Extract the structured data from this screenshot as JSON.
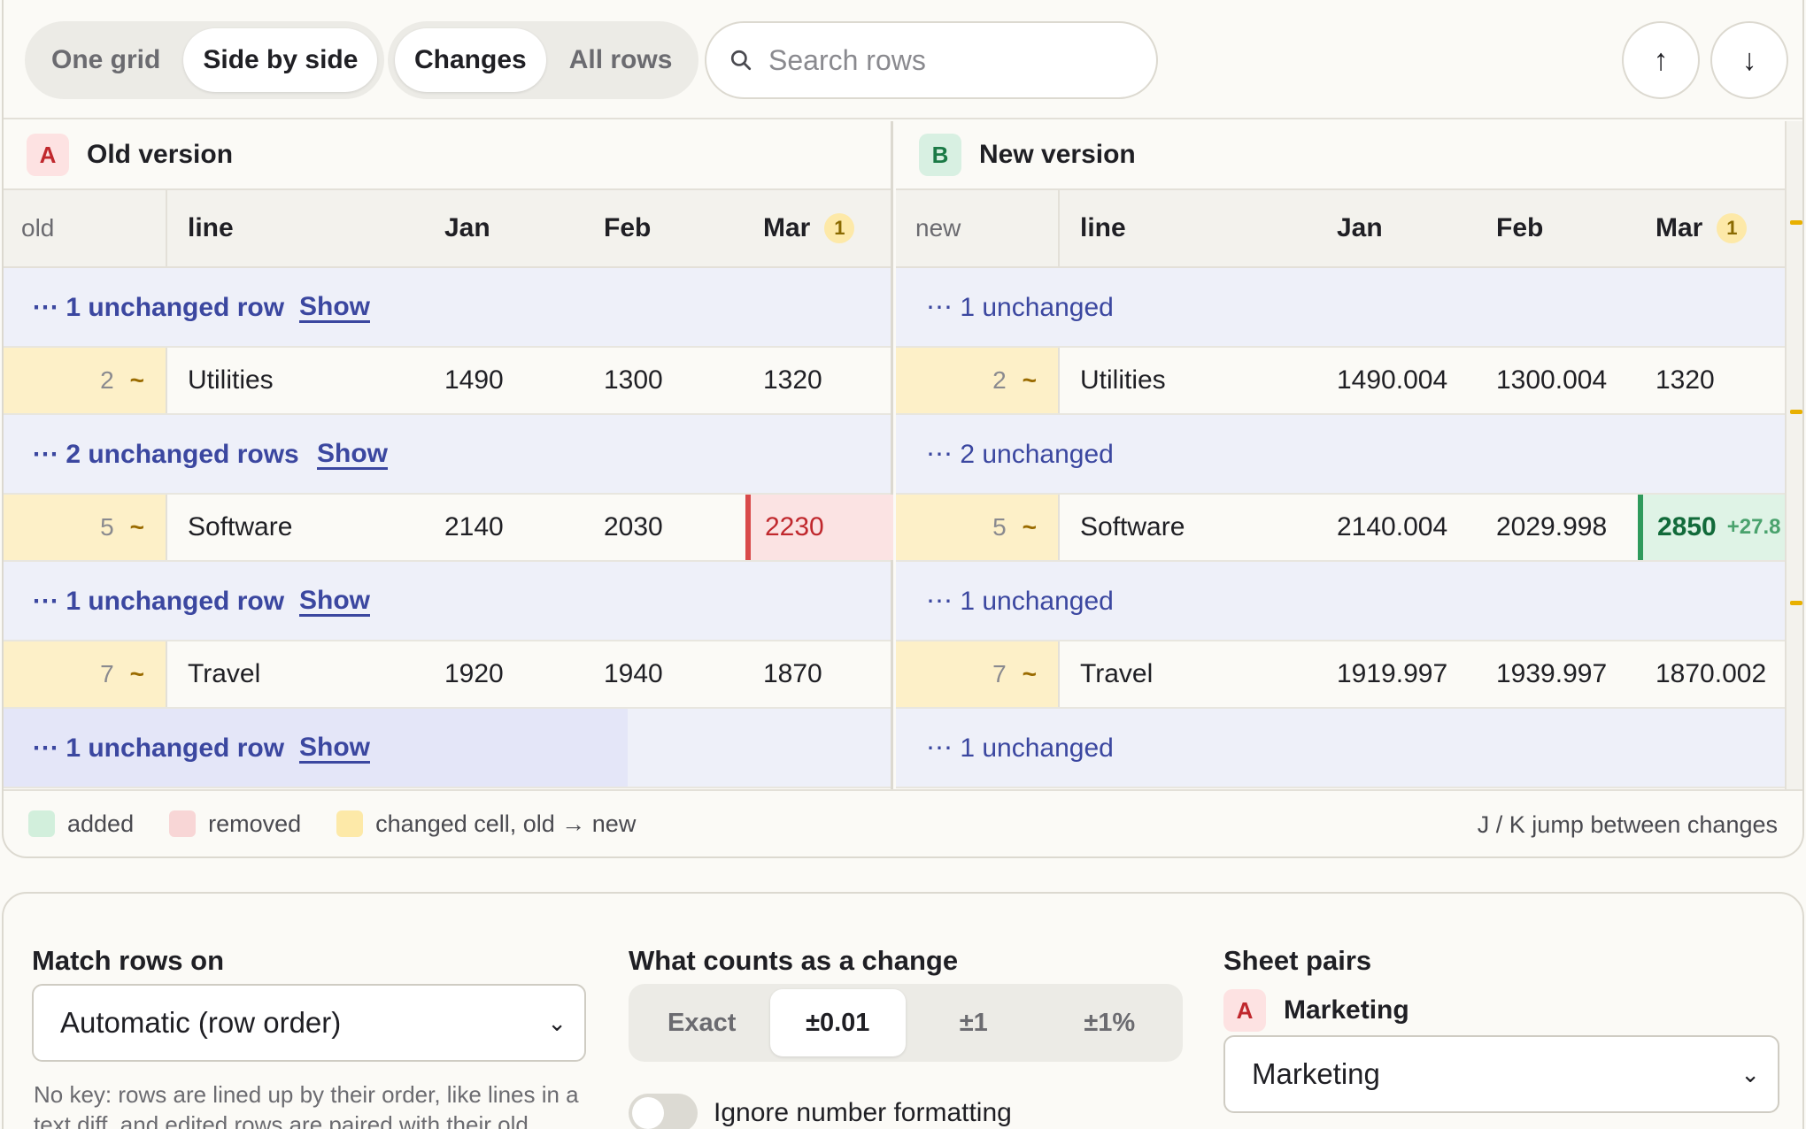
{
  "toolbar": {
    "view_modes": [
      "One grid",
      "Side by side"
    ],
    "row_modes": [
      "Changes",
      "All rows"
    ],
    "search_placeholder": "Search rows",
    "prev_label": "↑",
    "next_label": "↓"
  },
  "left_pane": {
    "badge": "A",
    "title": "Old version",
    "index_header": "old",
    "columns": [
      "line",
      "Jan",
      "Feb",
      "Mar"
    ],
    "mar_change_count": "1",
    "collapsed": [
      {
        "text": "⋯ 1 unchanged row",
        "show": "Show"
      },
      {
        "text": "⋯ 2 unchanged rows",
        "show": "Show"
      },
      {
        "text": "⋯ 1 unchanged row",
        "show": "Show"
      },
      {
        "text": "⋯ 1 unchanged row",
        "show": "Show"
      }
    ],
    "rows": [
      {
        "idx": "2",
        "mark": "~",
        "line": "Utilities",
        "jan": "1490",
        "feb": "1300",
        "mar": "1320"
      },
      {
        "idx": "5",
        "mark": "~",
        "line": "Software",
        "jan": "2140",
        "feb": "2030",
        "mar": "2230"
      },
      {
        "idx": "7",
        "mark": "~",
        "line": "Travel",
        "jan": "1920",
        "feb": "1940",
        "mar": "1870"
      }
    ]
  },
  "right_pane": {
    "badge": "B",
    "title": "New version",
    "index_header": "new",
    "columns": [
      "line",
      "Jan",
      "Feb",
      "Mar"
    ],
    "mar_change_count": "1",
    "collapsed": [
      "⋯ 1 unchanged",
      "⋯ 2 unchanged",
      "⋯ 1 unchanged",
      "⋯ 1 unchanged"
    ],
    "rows": [
      {
        "idx": "2",
        "mark": "~",
        "line": "Utilities",
        "jan": "1490.004",
        "feb": "1300.004",
        "mar": "1320"
      },
      {
        "idx": "5",
        "mark": "~",
        "line": "Software",
        "jan": "2140.004",
        "feb": "2029.998",
        "mar": "2850",
        "delta": "+27.8"
      },
      {
        "idx": "7",
        "mark": "~",
        "line": "Travel",
        "jan": "1919.997",
        "feb": "1939.997",
        "mar": "1870.002"
      }
    ]
  },
  "legend": {
    "added": "added",
    "removed": "removed",
    "changed": "changed cell, old → new",
    "shortcut": "J / K jump between changes"
  },
  "settings": {
    "match_label": "Match rows on",
    "match_value": "Automatic (row order)",
    "match_help": "No key: rows are lined up by their order, like lines in a text diff, and edited rows are paired with their old",
    "change_label": "What counts as a change",
    "tolerances": [
      "Exact",
      "±0.01",
      "±1",
      "±1%"
    ],
    "ignore_format_label": "Ignore number formatting",
    "pairs_label": "Sheet pairs",
    "pair_badge": "A",
    "pair_name": "Marketing",
    "pair_value": "Marketing"
  },
  "colors": {
    "added": "#d2efdc",
    "removed": "#f8d6d6",
    "changed": "#fde9a8",
    "accent": "#3b47a0"
  }
}
